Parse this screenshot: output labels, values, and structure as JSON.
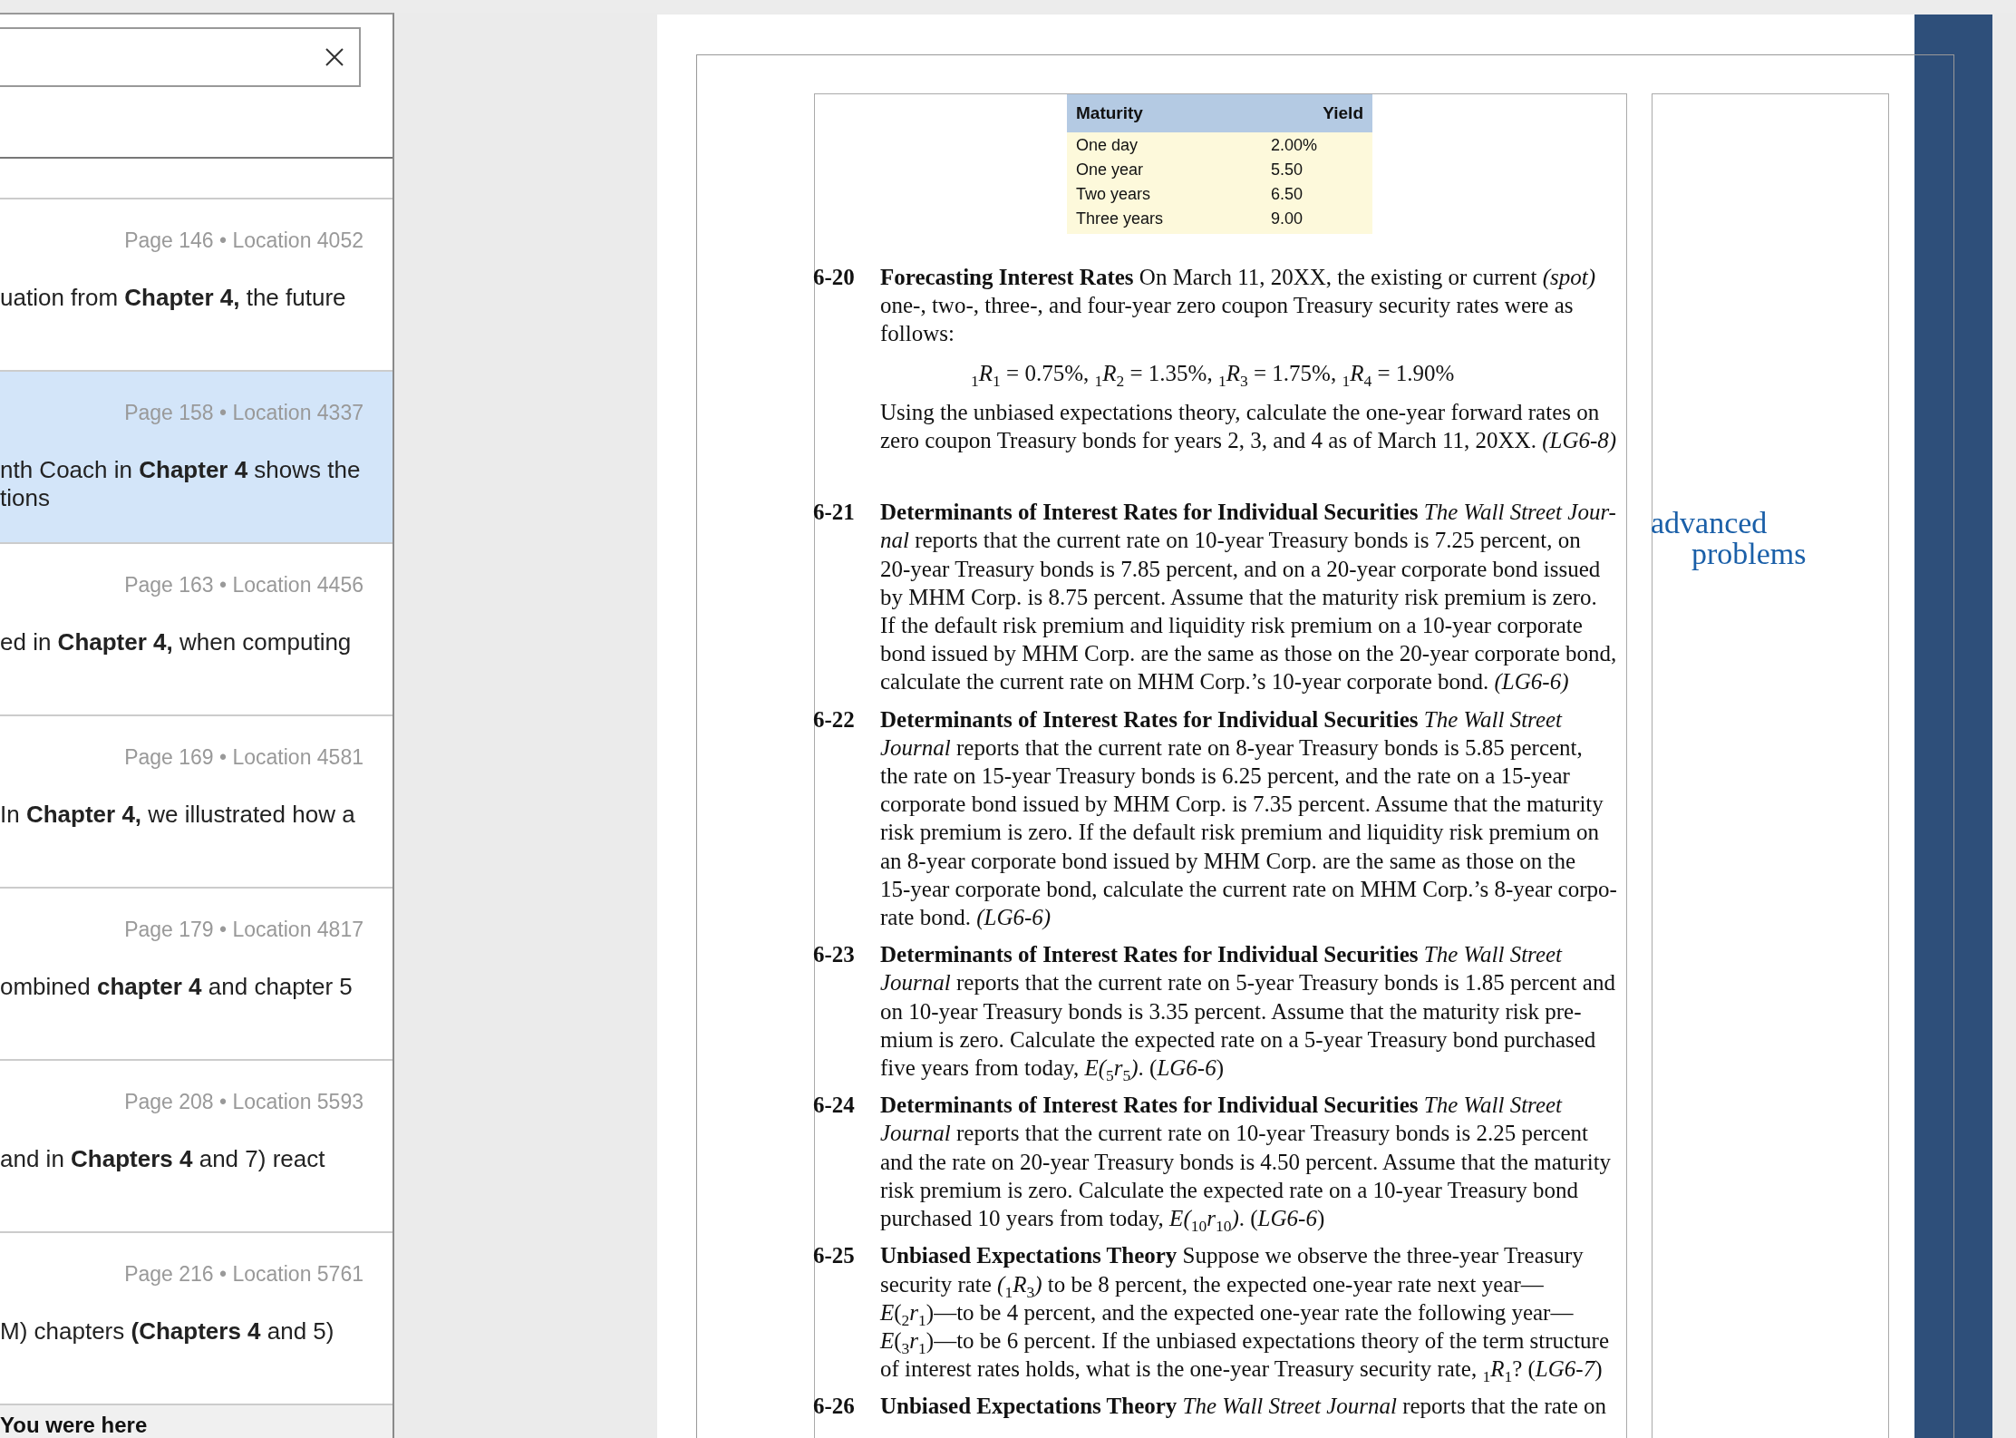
{
  "results": [
    {
      "meta": "Page 146 • Location 4052",
      "snippet": [
        "uation from **Chapter 4,** the future"
      ],
      "selected": false
    },
    {
      "meta": "Page 158 • Location 4337",
      "snippet": [
        "nth Coach in **Chapter 4** shows the",
        "tions"
      ],
      "selected": true
    },
    {
      "meta": "Page 163 • Location 4456",
      "snippet": [
        "ed in **Chapter 4,** when computing"
      ],
      "selected": false
    },
    {
      "meta": "Page 169 • Location 4581",
      "snippet": [
        "In **Chapter 4,** we illustrated how a"
      ],
      "selected": false
    },
    {
      "meta": "Page 179 • Location 4817",
      "snippet": [
        "ombined **chapter 4** and chapter 5"
      ],
      "selected": false
    },
    {
      "meta": "Page 208 • Location 5593",
      "snippet": [
        "and in **Chapters 4** and 7) react"
      ],
      "selected": false
    },
    {
      "meta": "Page 216 • Location 5761",
      "snippet": [
        "M) chapters **(Chapters 4** and 5)"
      ],
      "selected": false
    }
  ],
  "footer": {
    "label": "You were here"
  },
  "document": {
    "table": {
      "columns": [
        "Maturity",
        "Yield"
      ],
      "rows": [
        [
          "One day",
          "2.00%"
        ],
        [
          "One year",
          "5.50"
        ],
        [
          "Two years",
          "6.50"
        ],
        [
          "Three years",
          "9.00"
        ]
      ]
    },
    "problems": [
      {
        "number": "6-20",
        "paragraphs": [
          {
            "kind": "text",
            "lines": [
              "**Forecasting Interest Rates** On March 11, 20XX, the existing or current *(spot)*",
              "one-, two-, three-, and four-year zero coupon Treasury security rates were as",
              "follows:"
            ]
          },
          {
            "kind": "formula",
            "lines": [
              "$_{1}$*R*$_{1}$ = 0.75%, $_{1}$*R*$_{2}$ = 1.35%, $_{1}$*R*$_{3}$ = 1.75%, $_{1}$*R*$_{4}$ = 1.90%"
            ]
          },
          {
            "kind": "text",
            "lines": [
              "Using the unbiased expectations theory, calculate the one-year forward rates on",
              "zero coupon Treasury bonds for years 2, 3, and 4 as of March 11, 20XX. *(LG6-8)*"
            ]
          }
        ]
      },
      {
        "number": "6-21",
        "paragraphs": [
          {
            "kind": "text",
            "lines": [
              "**Determinants of Interest Rates for Individual Securities** *The Wall Street Jour-*",
              "*nal* reports that the current rate on 10-year Treasury bonds is 7.25 percent, on",
              "20-year Treasury bonds is 7.85 percent, and on a 20-year corporate bond issued",
              "by MHM Corp. is 8.75 percent. Assume that the maturity risk premium is zero.",
              "If the default risk premium and liquidity risk premium on a 10-year corporate",
              "bond issued by MHM Corp. are the same as those on the 20-year corporate bond,",
              "calculate the current rate on MHM Corp.’s 10-year corporate bond. *(LG6-6)*"
            ]
          }
        ]
      },
      {
        "number": "6-22",
        "paragraphs": [
          {
            "kind": "text",
            "lines": [
              "**Determinants of Interest Rates for Individual Securities** *The Wall Street*",
              "*Journal* reports that the current rate on 8-year Treasury bonds is 5.85 percent,",
              "the rate on 15-year Treasury bonds is 6.25 percent, and the rate on a 15-year",
              "corporate bond issued by MHM Corp. is 7.35 percent. Assume that the maturity",
              "risk premium is zero. If the default risk premium and liquidity risk premium on",
              "an 8-year corporate bond issued by MHM Corp. are the same as those on the",
              "15-year corporate bond, calculate the current rate on MHM Corp.’s 8-year corpo-",
              "rate bond. *(LG6-6)*"
            ]
          }
        ]
      },
      {
        "number": "6-23",
        "paragraphs": [
          {
            "kind": "text",
            "lines": [
              "**Determinants of Interest Rates for Individual Securities** *The Wall Street*",
              "*Journal* reports that the current rate on 5-year Treasury bonds is 1.85 percent and",
              "on 10-year Treasury bonds is 3.35 percent. Assume that the maturity risk pre-",
              "mium is zero. Calculate the expected rate on a 5-year Treasury bond purchased",
              "five years from today, *E(*$_{5}$*r*$_{5}$*)*. (*LG6-6*)"
            ]
          }
        ]
      },
      {
        "number": "6-24",
        "paragraphs": [
          {
            "kind": "text",
            "lines": [
              "**Determinants of Interest Rates for Individual Securities** *The Wall Street*",
              "*Journal* reports that the current rate on 10-year Treasury bonds is 2.25 percent",
              "and the rate on 20-year Treasury bonds is 4.50 percent. Assume that the maturity",
              "risk premium is zero. Calculate the expected rate on a 10-year Treasury bond",
              "purchased 10 years from today, *E(*$_{10}$*r*$_{10}$*)*. (*LG6-6*)"
            ]
          }
        ]
      },
      {
        "number": "6-25",
        "paragraphs": [
          {
            "kind": "text",
            "lines": [
              "**Unbiased Expectations Theory** Suppose we observe the three-year Treasury",
              "security rate *(*$_{1}$*R*$_{3}$*)* to be 8 percent, the expected one-year rate next year—",
              "*E*($_{2}$*r*$_{1}$)—to be 4 percent, and the expected one-year rate the following year—",
              "*E*($_{3}$*r*$_{1}$)—to be 6 percent. If the unbiased expectations theory of the term structure",
              "of interest rates holds, what is the one-year Treasury security rate, $_{1}$*R*$_{1}$? (*LG6-7*)"
            ]
          }
        ]
      },
      {
        "number": "6-26",
        "paragraphs": [
          {
            "kind": "text",
            "lines": [
              "**Unbiased Expectations Theory** *The Wall Street Journal* reports that the rate on"
            ]
          }
        ]
      }
    ],
    "margin_heading": [
      "advanced",
      "problems"
    ]
  }
}
